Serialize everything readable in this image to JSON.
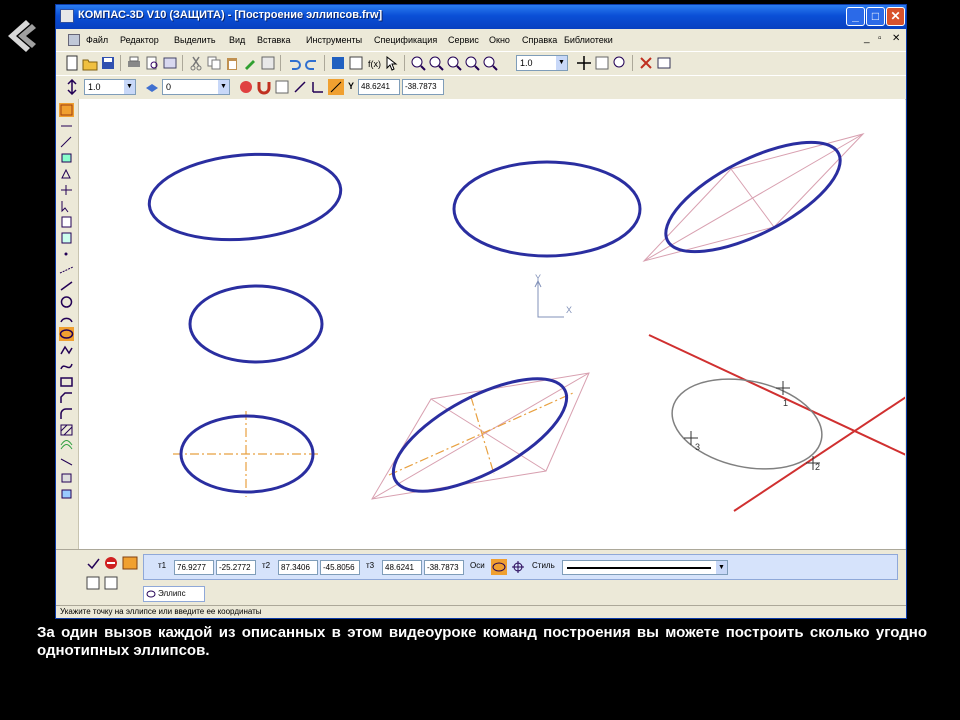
{
  "window": {
    "title": "КОМПАС-3D V10 (ЗАЩИТА) - [Построение эллипсов.frw]",
    "min_glyph": "_",
    "max_glyph": "□",
    "close_glyph": "✕"
  },
  "menu": {
    "items": [
      "Файл",
      "Редактор",
      "Выделить",
      "Вид",
      "Вставка",
      "Инструменты",
      "Спецификация",
      "Сервис",
      "Окно",
      "Справка",
      "Библиотеки"
    ],
    "mdi_controls": [
      "_",
      "▫",
      "✕"
    ]
  },
  "toolbar": {
    "zoom_value": "1.0",
    "style_value": "1.0",
    "layer_value": "0",
    "coord_x": "48.6241",
    "coord_y": "-38.7873",
    "coord_axis_label": "Y",
    "coord_unit_label": "X"
  },
  "canvas": {
    "axis_x_label": "X",
    "axis_y_label": "Y",
    "point_labels": [
      "1",
      "2",
      "3"
    ]
  },
  "properties": {
    "p1_label": "т1",
    "p1_x": "76.9277",
    "p1_y": "-25.2772",
    "p2_label": "т2",
    "p2_x": "87.3406",
    "p2_y": "-45.8056",
    "p3_label": "т3",
    "p3_x": "48.6241",
    "p3_y": "-38.7873",
    "axes_label": "Оси",
    "style_label": "Стиль",
    "tab_label": "Эллипс"
  },
  "status": {
    "hint": "Укажите точку на эллипсе или введите ее координаты"
  },
  "caption": {
    "text": "За один вызов каждой из описанных в этом видеоуроке команд построения вы можете построить сколько угодно однотипных эллипсов."
  },
  "colors": {
    "ellipse": "#2a2ea0",
    "construction": "#d8a0b0",
    "tangent": "#d03030",
    "axis_dash": "#e8a040",
    "phantom": "#808080"
  }
}
